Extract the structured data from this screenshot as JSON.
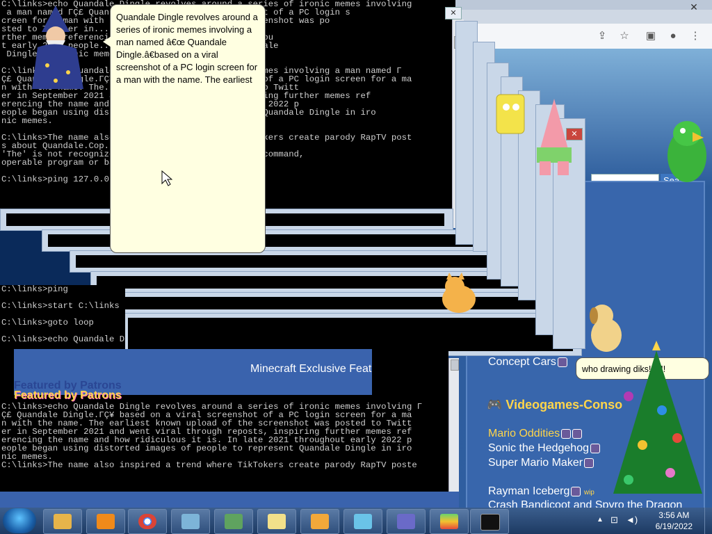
{
  "browser": {
    "close_glyph": "✕",
    "icons": [
      "share-icon",
      "star-icon",
      "sidebar-icon",
      "profile-icon",
      "menu-icon"
    ],
    "search_button": "Sea",
    "links": {
      "concept_cars": "Concept Cars",
      "section_videogames": "Videogames-Conso",
      "mario_oddities": "Mario Oddities",
      "sonic": "Sonic the Hedgehog",
      "smm": "Super Mario Maker",
      "rayman": "Rayman Iceberg",
      "crash": "Crash Bandicoot and Spyro the Dragon"
    }
  },
  "cmd": {
    "top_text": "C:\\links>echo Quandale Dingle revolves around a series of ironic memes involving\n a man named ΓÇ£ Quan... based on a viral screenshot of a PC login s\ncreen for a man with the name... upload of the screenshot was po\nsted to Twitter in... through reposts, inspiring fu\nrther memes referencing... is. In late 2021 throughou\nt early 2022 people... of people to represent Quandale\n Dingle in ironic memes.\n\nC:\\links>echo Quandale Dingle revolves... ironic memes involving a man named Γ\nÇ£ Quandale Dingle.ΓÇ¥ based on a viral screenshot of a PC login screen for a ma\nn with the name. The... the screenshot was posted to Twitt\ner in September 2021 and... through reposts, inspiring further memes ref\nerencing the name and... late 2021 throughout early 2022 p\neople began using distorted images of... represent Quandale Dingle in iro\nnic memes.\n\nC:\\links>The name also inspired a trend where TikTokers create parody RapTV post\ns about Quandale.Cop...\n'The' is not recognized as an internal or external command,\noperable program or batch file.\n\nC:\\links>ping 127.0.0.1",
    "middle_text": "C:\\links>ping\n\nC:\\links>start C:\\links\n\nC:\\links>goto loop\n\nC:\\links>echo Quandale Dingle revolves around a series of ironic memes involving",
    "bottom_text": "C:\\links>echo Quandale Dingle revolves around a series of ironic memes involving Γ\nÇ£ Quandale Dingle.ΓÇ¥ based on a viral screenshot of a PC login screen for a ma\nn with the name. The earliest known upload of the screenshot was posted to Twitt\ner in September 2021 and went viral through reposts, inspiring further memes ref\nerencing the name and how ridiculous it is. In late 2021 throughout early 2022 p\neople began using distorted images of people to represent Quandale Dingle in iro\nnic memes.\nC:\\links>The name also inspired a trend where TikTokers create parody RapTV poste",
    "close_glyph": "✕"
  },
  "balloon": {
    "text": "Quandale Dingle revolves around a series of ironic memes involving a man named â€œ Quandale Dingle.â€based on a viral screenshot of a PC login screen for a man with the name. The earliest"
  },
  "balloon2": {
    "text": "who drawing diks!!!!!!!"
  },
  "banner": {
    "title": "Minecraft Exclusive Feat",
    "featured": "Featured by Patrons",
    "featured_shadow": "Featured by Patrons"
  },
  "tags": {
    "wip": "wip"
  },
  "taskbar": {
    "time": "3:56 AM",
    "date": "6/19/2022",
    "apps": [
      "explorer",
      "media-player",
      "chrome",
      "image-viewer",
      "system-monitor",
      "file-manager",
      "notes",
      "atom",
      "virus",
      "bluestacks",
      "command-prompt"
    ]
  },
  "colors": {
    "cmd_bg": "#000000",
    "cmd_fg": "#cfcfcf",
    "balloon_bg": "#ffffe1",
    "site_blue": "#3866ac",
    "accent_gold": "#ffd54a",
    "banner_pink": "#ff66cc"
  }
}
